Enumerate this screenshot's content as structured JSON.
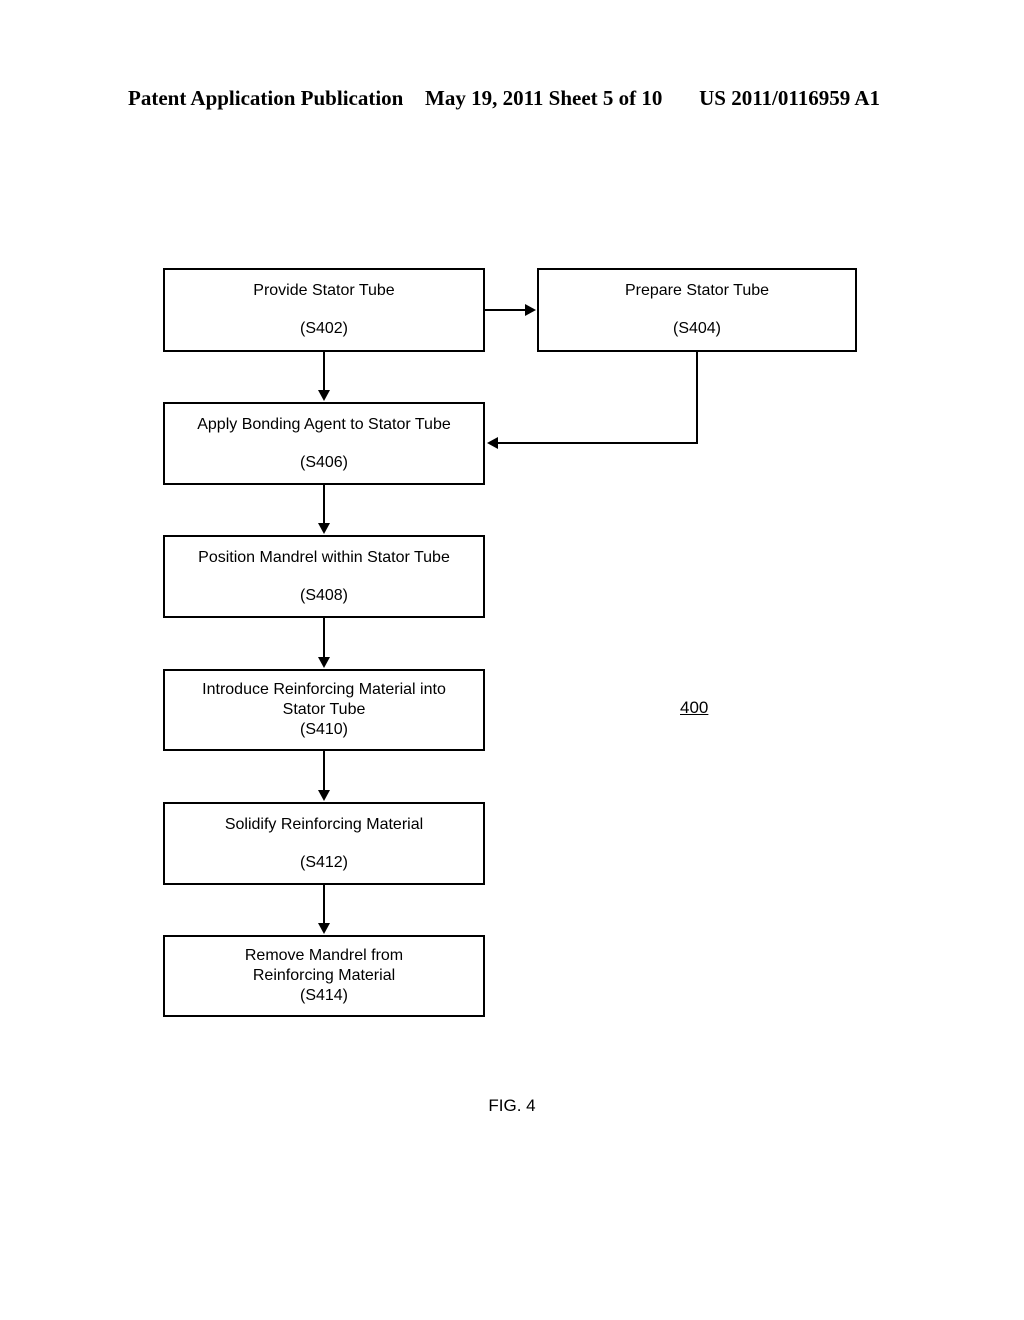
{
  "header": {
    "publication": "Patent Application Publication",
    "date_sheet": "May 19, 2011  Sheet 5 of 10",
    "doc_number": "US 2011/0116959 A1"
  },
  "figure": {
    "caption": "FIG. 4",
    "reference_numeral": "400"
  },
  "diagram": {
    "type": "flowchart",
    "nodes": [
      {
        "id": "S402",
        "title": "Provide Stator Tube",
        "step": "(S402)"
      },
      {
        "id": "S404",
        "title": "Prepare Stator Tube",
        "step": "(S404)"
      },
      {
        "id": "S406",
        "title": "Apply Bonding Agent to Stator Tube",
        "step": "(S406)"
      },
      {
        "id": "S408",
        "title": "Position Mandrel within Stator Tube",
        "step": "(S408)"
      },
      {
        "id": "S410",
        "title": "Introduce Reinforcing Material into\nStator Tube",
        "step": "(S410)"
      },
      {
        "id": "S412",
        "title": "Solidify Reinforcing Material",
        "step": "(S412)"
      },
      {
        "id": "S414",
        "title": "Remove Mandrel from\nReinforcing Material",
        "step": "(S414)"
      }
    ],
    "edges": [
      {
        "from": "S402",
        "to": "S404",
        "direction": "right"
      },
      {
        "from": "S402",
        "to": "S406",
        "direction": "down"
      },
      {
        "from": "S404",
        "to": "S406",
        "direction": "down-left"
      },
      {
        "from": "S406",
        "to": "S408",
        "direction": "down"
      },
      {
        "from": "S408",
        "to": "S410",
        "direction": "down"
      },
      {
        "from": "S410",
        "to": "S412",
        "direction": "down"
      },
      {
        "from": "S412",
        "to": "S414",
        "direction": "down"
      }
    ]
  },
  "colors": {
    "ink": "#000000",
    "paper": "#ffffff"
  }
}
